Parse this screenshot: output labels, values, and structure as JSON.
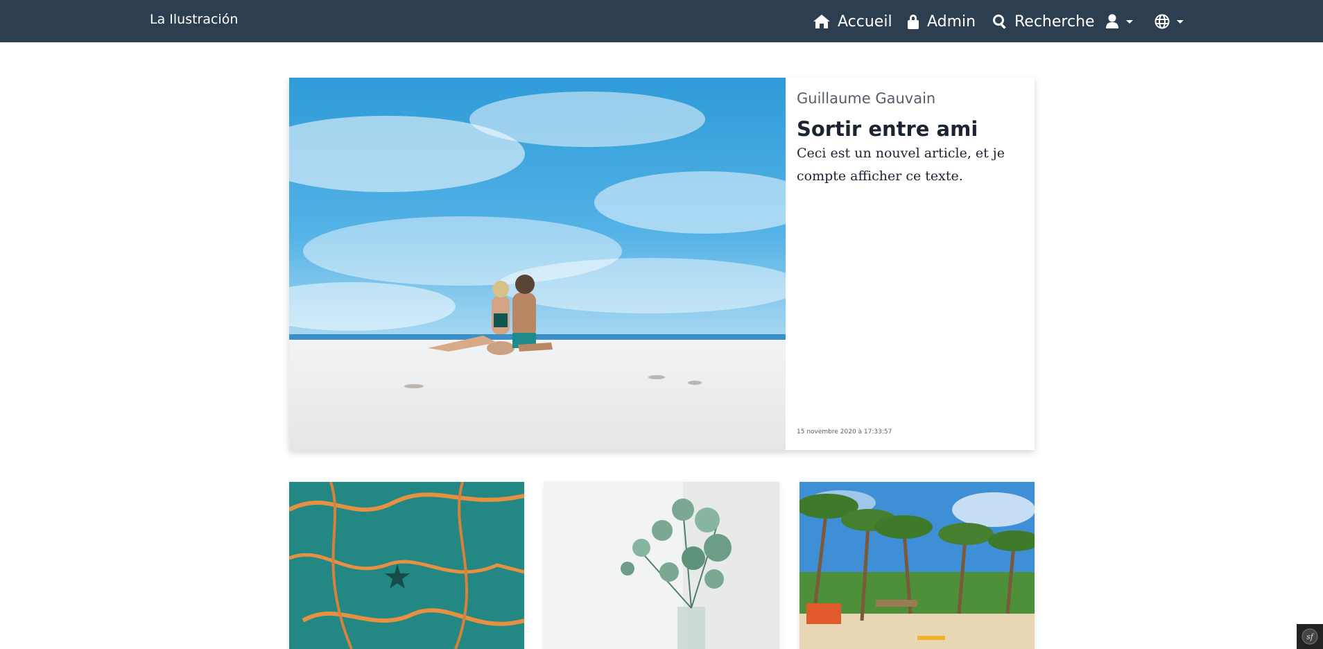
{
  "navbar": {
    "brand": "La Ilustración",
    "items": [
      {
        "label": "Accueil",
        "icon": "home-icon"
      },
      {
        "label": "Admin",
        "icon": "lock-icon"
      },
      {
        "label": "Recherche",
        "icon": "search-icon"
      }
    ],
    "user_menu_icon": "user-icon",
    "language_menu_icon": "globe-icon",
    "background": "#2c3e50"
  },
  "featured": {
    "author": "Guillaume Gauvain",
    "title": "Sortir entre ami",
    "excerpt": "Ceci est un nouvel article, et je compte afficher ce texte.",
    "date": "15 novembre 2020 à 17:33:57",
    "image": "beach-couple-photo"
  },
  "cards": [
    {
      "image": "starfish-underwater-photo"
    },
    {
      "image": "eucalyptus-vase-photo"
    },
    {
      "image": "palm-beach-photo"
    }
  ],
  "debug_toolbar": {
    "icon": "symfony-icon"
  }
}
